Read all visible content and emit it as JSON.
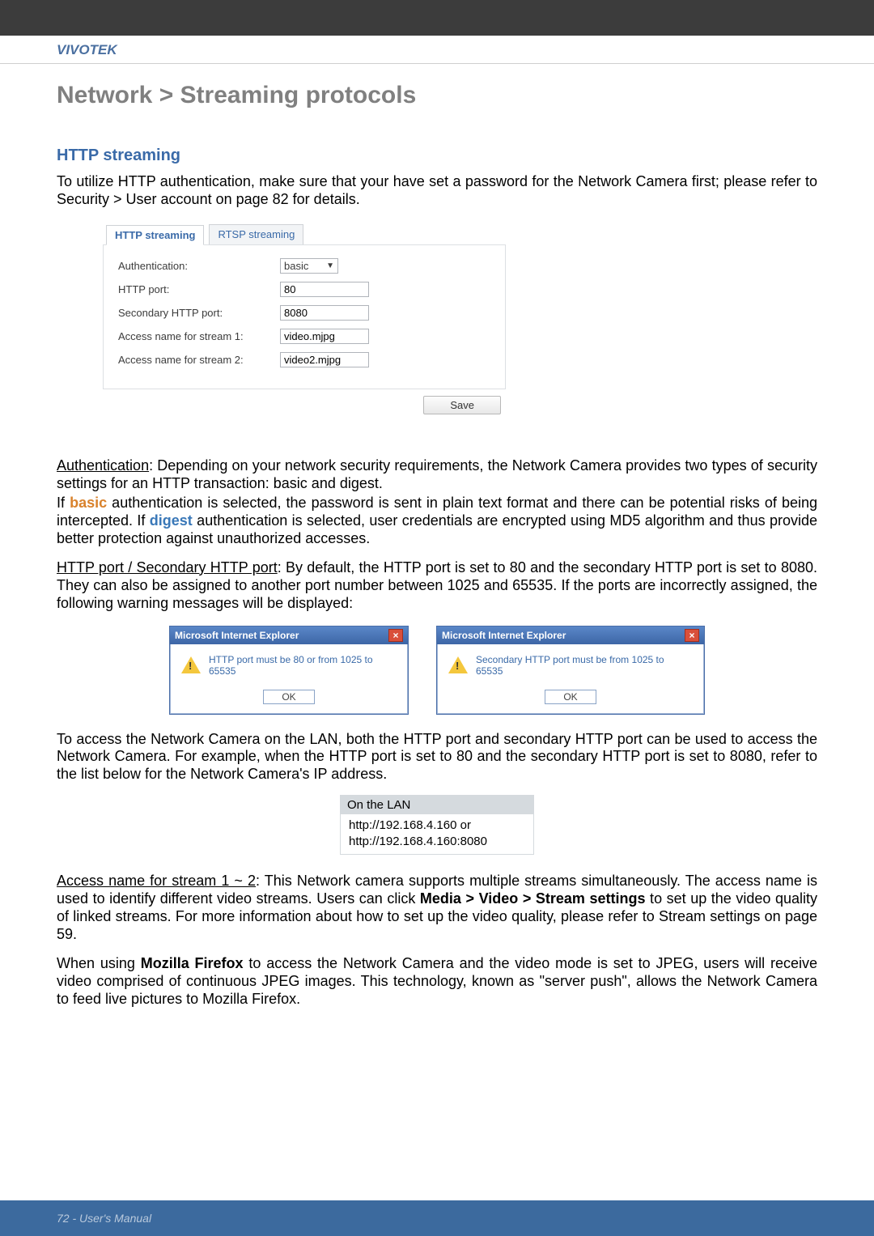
{
  "brand": "VIVOTEK",
  "page_title": "Network > Streaming protocols",
  "section_title": "HTTP streaming",
  "intro": "To utilize HTTP authentication, make sure that your have set a password for the Network Camera first; please refer to Security > User account on page 82 for details.",
  "config_panel": {
    "tabs": {
      "http": "HTTP streaming",
      "rtsp": "RTSP streaming"
    },
    "fields": {
      "auth_label": "Authentication:",
      "auth_value": "basic",
      "http_port_label": "HTTP port:",
      "http_port_value": "80",
      "sec_port_label": "Secondary HTTP port:",
      "sec_port_value": "8080",
      "stream1_label": "Access name for stream 1:",
      "stream1_value": "video.mjpg",
      "stream2_label": "Access name for stream 2:",
      "stream2_value": "video2.mjpg"
    },
    "save": "Save"
  },
  "auth_para_lead": "Authentication",
  "auth_para_rest": ": Depending on your network security requirements, the Network Camera provides two types of security settings for an HTTP transaction: basic and digest.",
  "auth_para2_pre": "If ",
  "auth_para2_basic": "basic",
  "auth_para2_mid": " authentication is selected, the password is sent in plain text format and there can be potential risks of being intercepted. If ",
  "auth_para2_digest": "digest",
  "auth_para2_post": " authentication is selected, user credentials are encrypted using MD5 algorithm and thus provide better protection against unauthorized accesses.",
  "ports_lead": "HTTP port / Secondary HTTP port",
  "ports_rest": ": By default, the HTTP port is set to 80 and the secondary HTTP port is set to 8080. They can also be assigned to another port number between 1025 and 65535. If the ports are incorrectly assigned, the following warning messages will be displayed:",
  "dialogs": {
    "title": "Microsoft Internet Explorer",
    "msg1": "HTTP port must be 80 or from 1025 to 65535",
    "msg2": "Secondary HTTP port must be from 1025 to 65535",
    "ok": "OK"
  },
  "access_lan_para": "To access the Network Camera on the LAN, both the HTTP port and secondary HTTP port can be used to access the Network Camera. For example, when the HTTP port is set to 80 and the secondary HTTP port is set to 8080, refer to the list below for the Network Camera's IP address.",
  "lan_box": {
    "head": "On the LAN",
    "line1": "http://192.168.4.160  or",
    "line2": "http://192.168.4.160:8080"
  },
  "access_name_lead": "Access name for stream 1 ~ 2",
  "access_name_rest1": ": This Network camera supports multiple streams simultaneously. The access name is used to identify different video streams. Users can click ",
  "access_name_bold": "Media > Video > Stream settings",
  "access_name_rest2": " to set up the video quality of linked streams. For more information about how to set up the video quality, please refer to Stream settings on page 59.",
  "firefox_pre": "When using ",
  "firefox_bold": "Mozilla Firefox",
  "firefox_post": " to access the Network Camera and the video mode is set to JPEG, users will receive video comprised of continuous JPEG images. This technology, known as \"server push\", allows the Network Camera to feed live pictures to Mozilla Firefox.",
  "footer": "72 - User's Manual"
}
